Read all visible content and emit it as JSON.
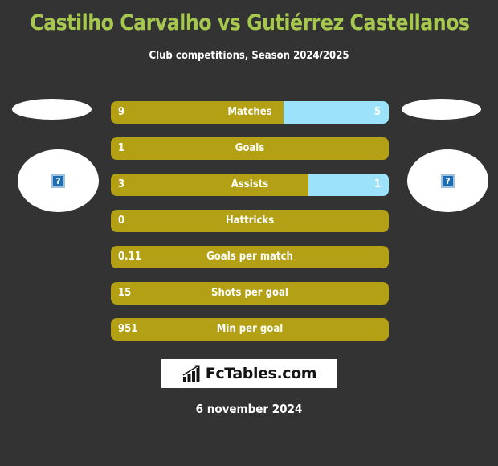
{
  "header": {
    "title": "Castilho Carvalho vs Gutiérrez Castellanos",
    "subtitle": "Club competitions, Season 2024/2025",
    "title_color": "#a6c84f"
  },
  "players": {
    "home": {
      "name": "",
      "photo_placeholder_icon": "broken-image-icon",
      "photo_placeholder_glyph": "?",
      "bar_color": "#b3a014"
    },
    "away": {
      "name": "",
      "photo_placeholder_icon": "broken-image-icon",
      "photo_placeholder_glyph": "?",
      "bar_color": "#9ce2fa"
    }
  },
  "chart_data": {
    "type": "bar",
    "title": "Castilho Carvalho vs Gutiérrez Castellanos",
    "subtitle": "Club competitions, Season 2024/2025",
    "orientation": "horizontal-diverging",
    "categories": [
      "Matches",
      "Goals",
      "Assists",
      "Hattricks",
      "Goals per match",
      "Shots per goal",
      "Min per goal"
    ],
    "series": [
      {
        "name": "Castilho Carvalho",
        "color": "#b3a014",
        "values": [
          9,
          1,
          3,
          0,
          0.11,
          15,
          951
        ],
        "display_values": [
          "9",
          "1",
          "3",
          "0",
          "0.11",
          "15",
          "951"
        ]
      },
      {
        "name": "Gutiérrez Castellanos",
        "color": "#9ce2fa",
        "values": [
          5,
          null,
          1,
          null,
          null,
          null,
          null
        ],
        "display_values": [
          "5",
          "",
          "1",
          "",
          "",
          "",
          ""
        ]
      }
    ],
    "home_share_pct": [
      62,
      100,
      71,
      100,
      100,
      100,
      100
    ],
    "grid": false,
    "legend": "none"
  },
  "rows": [
    {
      "label": "Matches",
      "home": "9",
      "away": "5",
      "home_pct": 62,
      "has_away": true
    },
    {
      "label": "Goals",
      "home": "1",
      "away": "",
      "home_pct": 100,
      "has_away": false
    },
    {
      "label": "Assists",
      "home": "3",
      "away": "1",
      "home_pct": 71,
      "has_away": true
    },
    {
      "label": "Hattricks",
      "home": "0",
      "away": "",
      "home_pct": 100,
      "has_away": false
    },
    {
      "label": "Goals per match",
      "home": "0.11",
      "away": "",
      "home_pct": 100,
      "has_away": false
    },
    {
      "label": "Shots per goal",
      "home": "15",
      "away": "",
      "home_pct": 100,
      "has_away": false
    },
    {
      "label": "Min per goal",
      "home": "951",
      "away": "",
      "home_pct": 100,
      "has_away": false
    }
  ],
  "footer": {
    "logo_text": "FcTables.com",
    "logo_icon": "bar-chart-growth-icon",
    "date": "6 november 2024"
  },
  "theme": {
    "background": "#333333",
    "accent_home": "#b3a014",
    "accent_away": "#9ce2fa",
    "title": "#a6c84f",
    "text": "#ffffff"
  }
}
